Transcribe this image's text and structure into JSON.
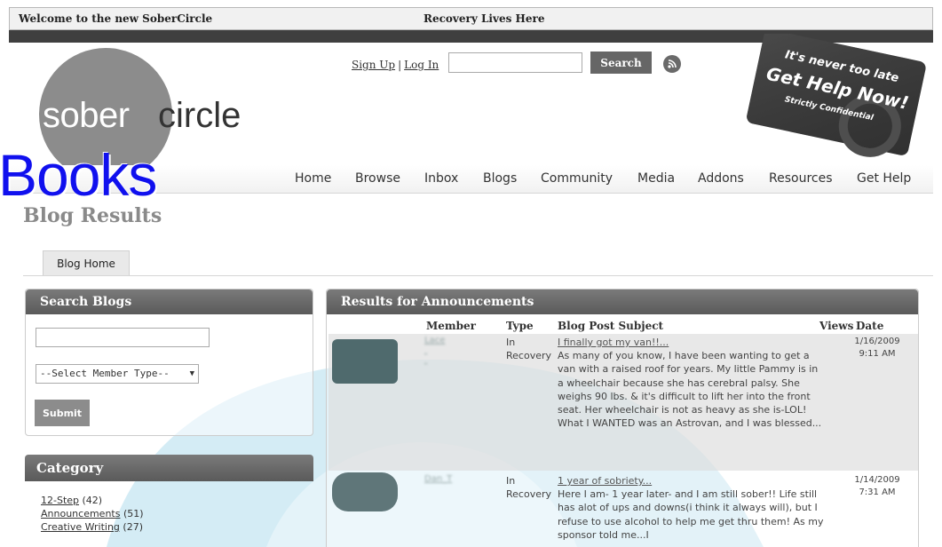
{
  "topbar": {
    "welcome": "Welcome to the new SoberCircle",
    "tagline": "Recovery Lives Here"
  },
  "logo": {
    "part1": "sober",
    "part2": "circle"
  },
  "auth": {
    "signup": "Sign Up",
    "separator": "|",
    "login": "Log In",
    "search_value": "",
    "search_button": "Search",
    "rss_icon": "rss-icon"
  },
  "help_badge": {
    "line1": "It's never too late",
    "line2": "Get Help Now!",
    "line3": "Strictly Confidential"
  },
  "nav": {
    "items": [
      "Home",
      "Browse",
      "Inbox",
      "Blogs",
      "Community",
      "Media",
      "Addons",
      "Resources",
      "Get Help"
    ]
  },
  "overlay_text": "Books",
  "page_title": "Blog Results",
  "tabs": {
    "blog_home": "Blog Home"
  },
  "search_panel": {
    "title": "Search Blogs",
    "input_value": "",
    "member_type_selected": "--Select Member Type--",
    "submit": "Submit"
  },
  "category_panel": {
    "title": "Category",
    "items": [
      {
        "label": "12-Step",
        "count": "(42)"
      },
      {
        "label": "Announcements",
        "count": "(51)"
      },
      {
        "label": "Creative Writing",
        "count": "(27)"
      }
    ]
  },
  "results": {
    "title": "Results for Announcements",
    "columns": [
      "Member",
      "Type",
      "Blog Post Subject",
      "Views",
      "Date"
    ],
    "rows": [
      {
        "type": "In Recovery",
        "subject": "I finally got my van!!...",
        "body": "As many of you know, I have been wanting to get a van with a raised roof for years.  My little Pammy is in a wheelchair because she has cerebral palsy.  She weighs 90 lbs. & it's difficult to lift her into the front seat.  Her wheelchair is not as heavy as she is-LOL!  What I WANTED was an Astrovan, and I was blessed...",
        "date": "1/16/2009",
        "time": "9:11 AM"
      },
      {
        "type": "In Recovery",
        "subject": "1 year of sobriety...",
        "body": "Here I am- 1 year later- and I am still sober!! Life still has alot of ups and downs(i think it always will), but I refuse to use alcohol to help me get thru them! As my sponsor told me...I",
        "date": "1/14/2009",
        "time": "7:31 AM"
      }
    ]
  },
  "colors": {
    "accent_blue_overlay": "#1010ee",
    "panel_header": "#5a5a5a",
    "swoosh": "#cfe8f3"
  }
}
